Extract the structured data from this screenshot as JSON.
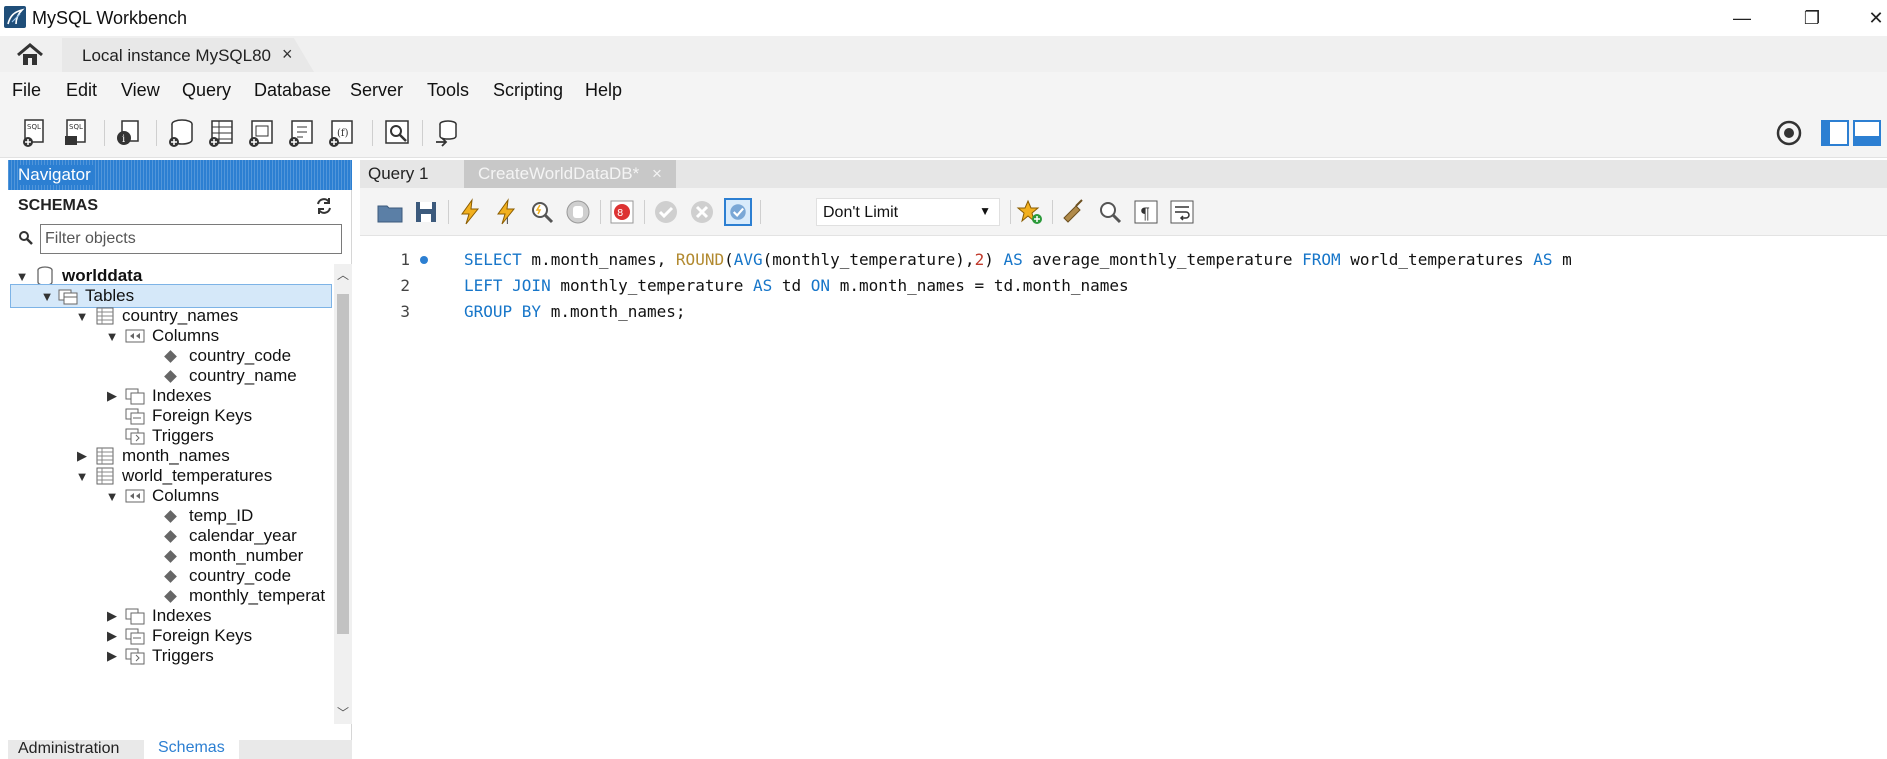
{
  "window": {
    "title": "MySQL Workbench",
    "controls": {
      "minimize": "—",
      "maximize": "❐",
      "close": "✕"
    }
  },
  "connection_tab": {
    "label": "Local instance MySQL80",
    "close": "×"
  },
  "menu": [
    "File",
    "Edit",
    "View",
    "Query",
    "Database",
    "Server",
    "Tools",
    "Scripting",
    "Help"
  ],
  "navigator": {
    "header": "Navigator",
    "schemas_label": "SCHEMAS",
    "filter_placeholder": "Filter objects",
    "tree": [
      {
        "label": "worlddata",
        "twisty": "▼",
        "kind": "schema",
        "bold": true
      },
      {
        "label": "Tables",
        "twisty": "▼",
        "kind": "folder",
        "selected": true
      },
      {
        "label": "country_names",
        "twisty": "▼",
        "kind": "table"
      },
      {
        "label": "Columns",
        "twisty": "▼",
        "kind": "columns"
      },
      {
        "label": "country_code",
        "kind": "column"
      },
      {
        "label": "country_name",
        "kind": "column"
      },
      {
        "label": "Indexes",
        "twisty": "▶",
        "kind": "folder"
      },
      {
        "label": "Foreign Keys",
        "twisty": "",
        "kind": "folder"
      },
      {
        "label": "Triggers",
        "twisty": "",
        "kind": "folder"
      },
      {
        "label": "month_names",
        "twisty": "▶",
        "kind": "table"
      },
      {
        "label": "world_temperatures",
        "twisty": "▼",
        "kind": "table"
      },
      {
        "label": "Columns",
        "twisty": "▼",
        "kind": "columns"
      },
      {
        "label": "temp_ID",
        "kind": "column"
      },
      {
        "label": "calendar_year",
        "kind": "column"
      },
      {
        "label": "month_number",
        "kind": "column"
      },
      {
        "label": "country_code",
        "kind": "column"
      },
      {
        "label": "monthly_temperat",
        "kind": "column"
      },
      {
        "label": "Indexes",
        "twisty": "▶",
        "kind": "folder"
      },
      {
        "label": "Foreign Keys",
        "twisty": "▶",
        "kind": "folder"
      },
      {
        "label": "Triggers",
        "twisty": "▶",
        "kind": "folder"
      }
    ],
    "bottom_tabs": {
      "administration": "Administration",
      "schemas": "Schemas"
    }
  },
  "editor": {
    "tabs": [
      {
        "label": "Query 1",
        "active": true
      },
      {
        "label": "CreateWorldDataDB*",
        "active": false,
        "close": "×"
      }
    ],
    "limit_select": "Don't Limit",
    "lines": [
      {
        "num": "1",
        "marker": true,
        "tokens": [
          {
            "t": "SELECT",
            "c": "kw"
          },
          {
            "t": " m.month_names, ",
            "c": ""
          },
          {
            "t": "ROUND",
            "c": "fn"
          },
          {
            "t": "(",
            "c": ""
          },
          {
            "t": "AVG",
            "c": "kw"
          },
          {
            "t": "(monthly_temperature),",
            "c": ""
          },
          {
            "t": "2",
            "c": "num"
          },
          {
            "t": ") ",
            "c": ""
          },
          {
            "t": "AS",
            "c": "kw"
          },
          {
            "t": " average_monthly_temperature ",
            "c": ""
          },
          {
            "t": "FROM",
            "c": "kw"
          },
          {
            "t": " world_temperatures ",
            "c": ""
          },
          {
            "t": "AS",
            "c": "kw"
          },
          {
            "t": " m",
            "c": ""
          }
        ]
      },
      {
        "num": "2",
        "marker": false,
        "tokens": [
          {
            "t": "LEFT JOIN",
            "c": "kw"
          },
          {
            "t": " monthly_temperature ",
            "c": ""
          },
          {
            "t": "AS",
            "c": "kw"
          },
          {
            "t": " td ",
            "c": ""
          },
          {
            "t": "ON",
            "c": "kw"
          },
          {
            "t": " m.month_names = td.month_names",
            "c": ""
          }
        ]
      },
      {
        "num": "3",
        "marker": false,
        "tokens": [
          {
            "t": "GROUP BY",
            "c": "kw"
          },
          {
            "t": " m.month_names;",
            "c": ""
          }
        ]
      }
    ]
  },
  "colors": {
    "accent": "#2c7fd2",
    "keyword": "#1776c9",
    "function": "#b28a30",
    "number": "#c0392b"
  }
}
